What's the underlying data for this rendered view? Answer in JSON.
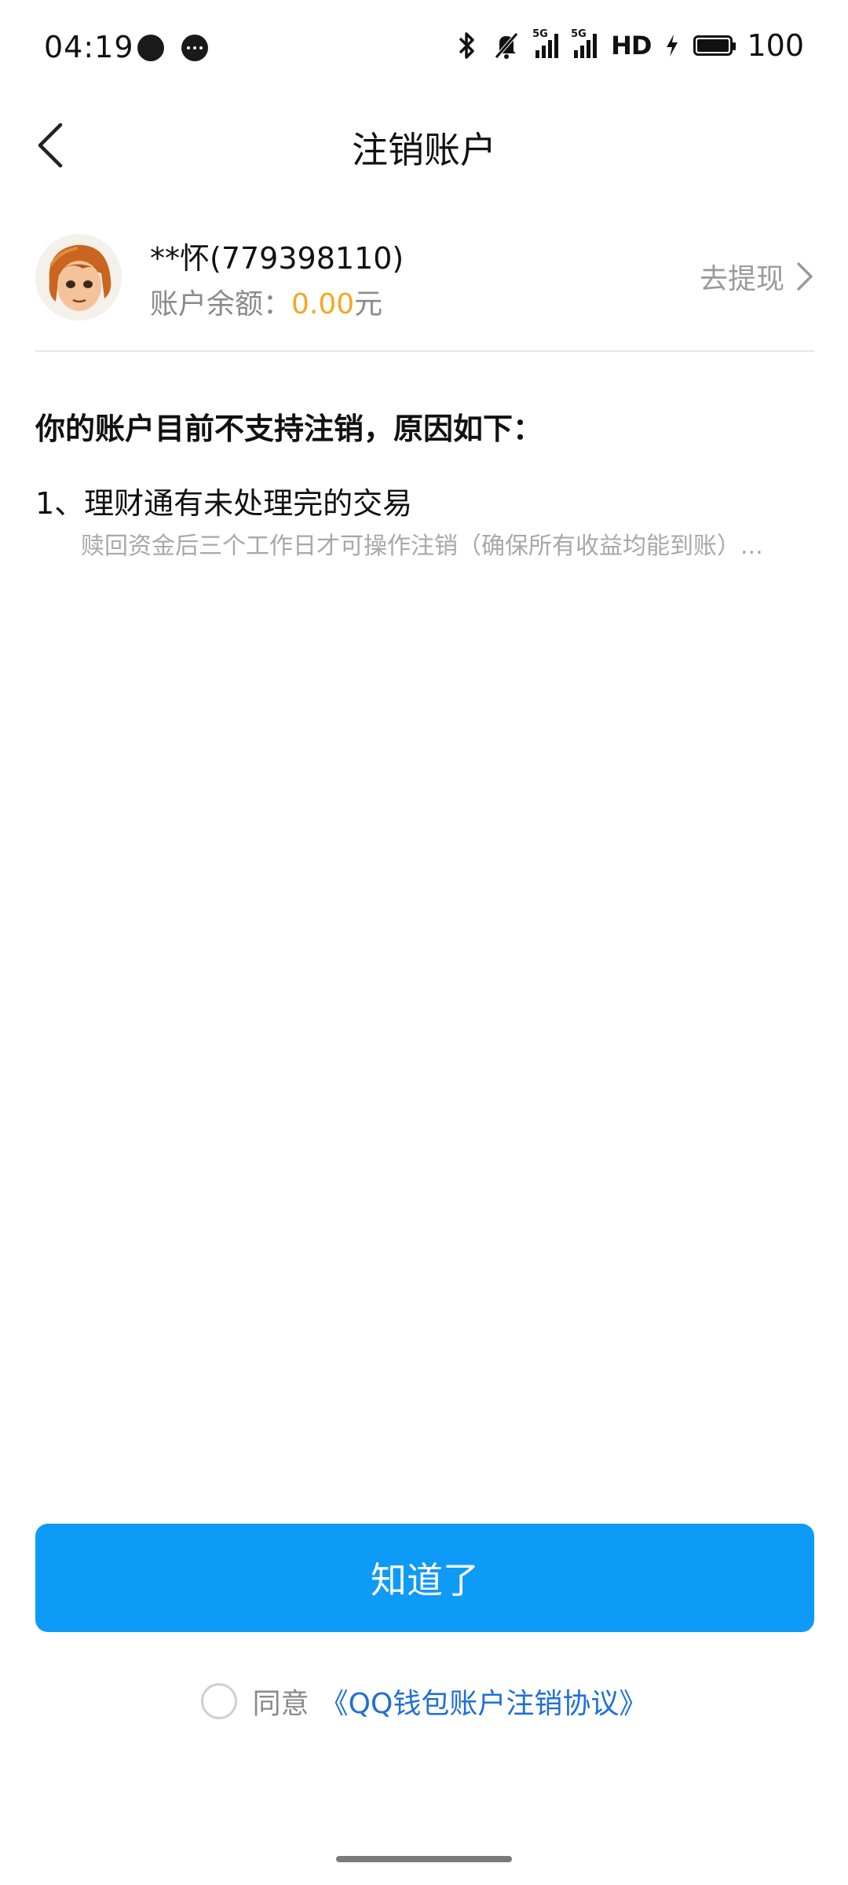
{
  "status_bar": {
    "time": "04:19",
    "network_hd": "HD",
    "battery_level": "100",
    "signal_tag_1": "5G",
    "signal_tag_2": "5G"
  },
  "nav": {
    "title": "注销账户"
  },
  "account": {
    "name": "**怀(779398110)",
    "balance_label": "账户余额：",
    "balance_amount": "0.00",
    "balance_unit": "元",
    "withdraw_label": "去提现"
  },
  "reasons": {
    "title": "你的账户目前不支持注销，原因如下：",
    "items": [
      {
        "title": "1、理财通有未处理完的交易",
        "desc": "赎回资金后三个工作日才可操作注销（确保所有收益均能到账）..."
      }
    ]
  },
  "actions": {
    "confirm_label": "知道了"
  },
  "agreement": {
    "label": "同意",
    "link": "《QQ钱包账户注销协议》"
  },
  "colors": {
    "primary": "#0e9af7",
    "amount": "#f5a623",
    "link": "#1f6fd8"
  }
}
